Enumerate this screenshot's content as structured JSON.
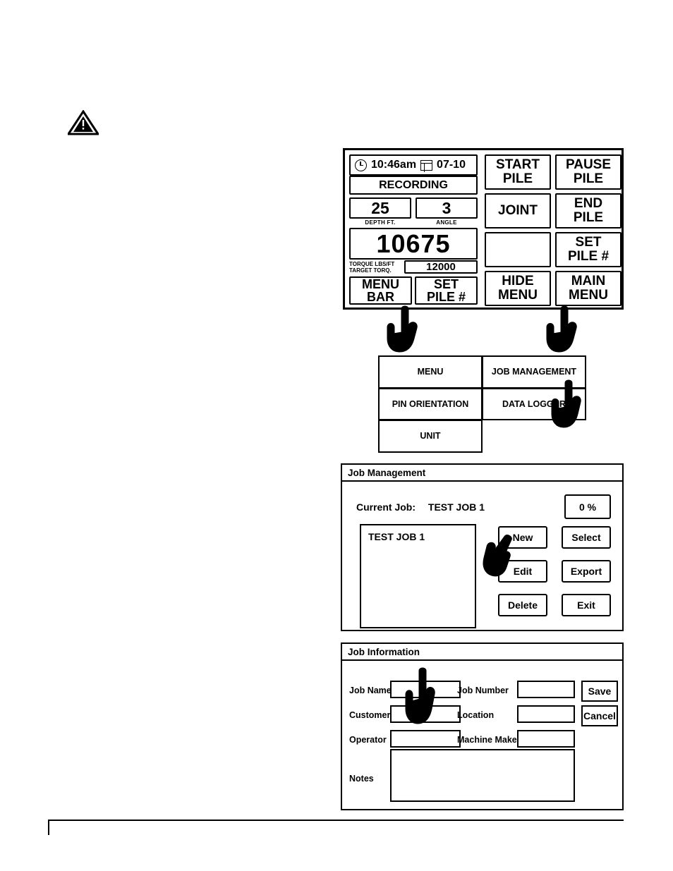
{
  "control_panel": {
    "status": {
      "clock_icon": "clock-icon",
      "time": "10:46am",
      "calendar_icon": "calendar-icon",
      "date": "07-10",
      "recording": "RECORDING"
    },
    "depth": {
      "value": "25",
      "caption": "DEPTH FT."
    },
    "angle": {
      "value": "3",
      "caption": "ANGLE"
    },
    "torque": {
      "value": "10675",
      "label_line1": "TORQUE  LBS/FT",
      "label_line2": "TARGET TORQ.",
      "target": "12000"
    },
    "left_buttons": [
      {
        "label": "MENU BAR",
        "name": "menu-bar-button"
      },
      {
        "label": "SET PILE #",
        "name": "set-pile-number-button-left"
      }
    ],
    "right_buttons": [
      {
        "label": "START PILE",
        "name": "start-pile-button"
      },
      {
        "label": "PAUSE PILE",
        "name": "pause-pile-button"
      },
      {
        "label": "JOINT",
        "name": "joint-button"
      },
      {
        "label": "END PILE",
        "name": "end-pile-button"
      },
      {
        "label": "",
        "name": "blank-button"
      },
      {
        "label": "SET PILE #",
        "name": "set-pile-number-button"
      },
      {
        "label": "HIDE MENU",
        "name": "hide-menu-button"
      },
      {
        "label": "MAIN MENU",
        "name": "main-menu-button"
      }
    ]
  },
  "menu_grid": {
    "items": [
      {
        "label": "MENU",
        "name": "menu-item-menu"
      },
      {
        "label": "JOB MANAGEMENT",
        "name": "menu-item-job-management"
      },
      {
        "label": "PIN ORIENTATION",
        "name": "menu-item-pin-orientation"
      },
      {
        "label": "DATA LOGGER",
        "name": "menu-item-data-logger"
      },
      {
        "label": "UNIT",
        "name": "menu-item-unit"
      }
    ]
  },
  "job_management": {
    "title": "Job Management",
    "current_job_label": "Current Job:",
    "current_job_value": "TEST JOB 1",
    "percent": "0 %",
    "list_items": [
      "TEST JOB 1"
    ],
    "buttons": [
      {
        "label": "New",
        "name": "new-job-button"
      },
      {
        "label": "Select",
        "name": "select-job-button"
      },
      {
        "label": "Edit",
        "name": "edit-job-button"
      },
      {
        "label": "Export",
        "name": "export-job-button"
      },
      {
        "label": "Delete",
        "name": "delete-job-button"
      },
      {
        "label": "Exit",
        "name": "exit-job-management-button"
      }
    ]
  },
  "job_information": {
    "title": "Job Information",
    "fields": [
      {
        "label": "Job Name",
        "value": "",
        "name": "job-name-field"
      },
      {
        "label": "Customer",
        "value": "",
        "name": "customer-field"
      },
      {
        "label": "Operator",
        "value": "",
        "name": "operator-field"
      },
      {
        "label": "Job Number",
        "value": "",
        "name": "job-number-field"
      },
      {
        "label": "Location",
        "value": "",
        "name": "location-field"
      },
      {
        "label": "Machine Make",
        "value": "",
        "name": "machine-make-field"
      },
      {
        "label": "Notes",
        "value": "",
        "name": "notes-field"
      }
    ],
    "buttons": [
      {
        "label": "Save",
        "name": "save-button"
      },
      {
        "label": "Cancel",
        "name": "cancel-button"
      }
    ]
  }
}
